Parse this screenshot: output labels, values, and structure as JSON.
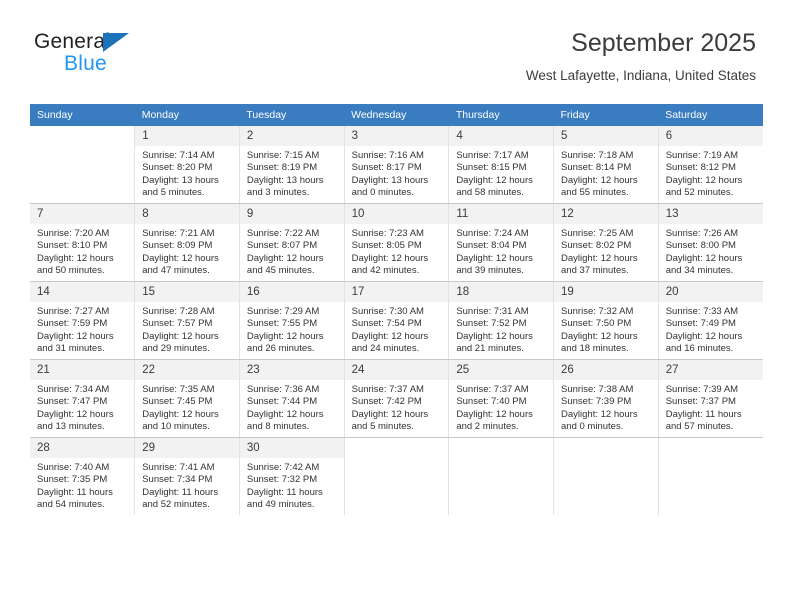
{
  "brand": {
    "name_top": "General",
    "name_bottom": "Blue",
    "triangle_color": "#1c72bb",
    "blue_color": "#2196f3"
  },
  "header": {
    "title": "September 2025",
    "subtitle": "West Lafayette, Indiana, United States"
  },
  "theme": {
    "header_row_bg": "#3a7cc0",
    "header_row_text": "#ffffff",
    "daynum_bg": "#f2f2f2",
    "cell_text": "#333333"
  },
  "weekday_headers": [
    "Sunday",
    "Monday",
    "Tuesday",
    "Wednesday",
    "Thursday",
    "Friday",
    "Saturday"
  ],
  "weeks": [
    [
      {
        "day": "",
        "sunrise": "",
        "sunset": "",
        "daylight_line1": "",
        "daylight_line2": "",
        "blank": true
      },
      {
        "day": "1",
        "sunrise": "Sunrise: 7:14 AM",
        "sunset": "Sunset: 8:20 PM",
        "daylight_line1": "Daylight: 13 hours",
        "daylight_line2": "and 5 minutes."
      },
      {
        "day": "2",
        "sunrise": "Sunrise: 7:15 AM",
        "sunset": "Sunset: 8:19 PM",
        "daylight_line1": "Daylight: 13 hours",
        "daylight_line2": "and 3 minutes."
      },
      {
        "day": "3",
        "sunrise": "Sunrise: 7:16 AM",
        "sunset": "Sunset: 8:17 PM",
        "daylight_line1": "Daylight: 13 hours",
        "daylight_line2": "and 0 minutes."
      },
      {
        "day": "4",
        "sunrise": "Sunrise: 7:17 AM",
        "sunset": "Sunset: 8:15 PM",
        "daylight_line1": "Daylight: 12 hours",
        "daylight_line2": "and 58 minutes."
      },
      {
        "day": "5",
        "sunrise": "Sunrise: 7:18 AM",
        "sunset": "Sunset: 8:14 PM",
        "daylight_line1": "Daylight: 12 hours",
        "daylight_line2": "and 55 minutes."
      },
      {
        "day": "6",
        "sunrise": "Sunrise: 7:19 AM",
        "sunset": "Sunset: 8:12 PM",
        "daylight_line1": "Daylight: 12 hours",
        "daylight_line2": "and 52 minutes."
      }
    ],
    [
      {
        "day": "7",
        "sunrise": "Sunrise: 7:20 AM",
        "sunset": "Sunset: 8:10 PM",
        "daylight_line1": "Daylight: 12 hours",
        "daylight_line2": "and 50 minutes."
      },
      {
        "day": "8",
        "sunrise": "Sunrise: 7:21 AM",
        "sunset": "Sunset: 8:09 PM",
        "daylight_line1": "Daylight: 12 hours",
        "daylight_line2": "and 47 minutes."
      },
      {
        "day": "9",
        "sunrise": "Sunrise: 7:22 AM",
        "sunset": "Sunset: 8:07 PM",
        "daylight_line1": "Daylight: 12 hours",
        "daylight_line2": "and 45 minutes."
      },
      {
        "day": "10",
        "sunrise": "Sunrise: 7:23 AM",
        "sunset": "Sunset: 8:05 PM",
        "daylight_line1": "Daylight: 12 hours",
        "daylight_line2": "and 42 minutes."
      },
      {
        "day": "11",
        "sunrise": "Sunrise: 7:24 AM",
        "sunset": "Sunset: 8:04 PM",
        "daylight_line1": "Daylight: 12 hours",
        "daylight_line2": "and 39 minutes."
      },
      {
        "day": "12",
        "sunrise": "Sunrise: 7:25 AM",
        "sunset": "Sunset: 8:02 PM",
        "daylight_line1": "Daylight: 12 hours",
        "daylight_line2": "and 37 minutes."
      },
      {
        "day": "13",
        "sunrise": "Sunrise: 7:26 AM",
        "sunset": "Sunset: 8:00 PM",
        "daylight_line1": "Daylight: 12 hours",
        "daylight_line2": "and 34 minutes."
      }
    ],
    [
      {
        "day": "14",
        "sunrise": "Sunrise: 7:27 AM",
        "sunset": "Sunset: 7:59 PM",
        "daylight_line1": "Daylight: 12 hours",
        "daylight_line2": "and 31 minutes."
      },
      {
        "day": "15",
        "sunrise": "Sunrise: 7:28 AM",
        "sunset": "Sunset: 7:57 PM",
        "daylight_line1": "Daylight: 12 hours",
        "daylight_line2": "and 29 minutes."
      },
      {
        "day": "16",
        "sunrise": "Sunrise: 7:29 AM",
        "sunset": "Sunset: 7:55 PM",
        "daylight_line1": "Daylight: 12 hours",
        "daylight_line2": "and 26 minutes."
      },
      {
        "day": "17",
        "sunrise": "Sunrise: 7:30 AM",
        "sunset": "Sunset: 7:54 PM",
        "daylight_line1": "Daylight: 12 hours",
        "daylight_line2": "and 24 minutes."
      },
      {
        "day": "18",
        "sunrise": "Sunrise: 7:31 AM",
        "sunset": "Sunset: 7:52 PM",
        "daylight_line1": "Daylight: 12 hours",
        "daylight_line2": "and 21 minutes."
      },
      {
        "day": "19",
        "sunrise": "Sunrise: 7:32 AM",
        "sunset": "Sunset: 7:50 PM",
        "daylight_line1": "Daylight: 12 hours",
        "daylight_line2": "and 18 minutes."
      },
      {
        "day": "20",
        "sunrise": "Sunrise: 7:33 AM",
        "sunset": "Sunset: 7:49 PM",
        "daylight_line1": "Daylight: 12 hours",
        "daylight_line2": "and 16 minutes."
      }
    ],
    [
      {
        "day": "21",
        "sunrise": "Sunrise: 7:34 AM",
        "sunset": "Sunset: 7:47 PM",
        "daylight_line1": "Daylight: 12 hours",
        "daylight_line2": "and 13 minutes."
      },
      {
        "day": "22",
        "sunrise": "Sunrise: 7:35 AM",
        "sunset": "Sunset: 7:45 PM",
        "daylight_line1": "Daylight: 12 hours",
        "daylight_line2": "and 10 minutes."
      },
      {
        "day": "23",
        "sunrise": "Sunrise: 7:36 AM",
        "sunset": "Sunset: 7:44 PM",
        "daylight_line1": "Daylight: 12 hours",
        "daylight_line2": "and 8 minutes."
      },
      {
        "day": "24",
        "sunrise": "Sunrise: 7:37 AM",
        "sunset": "Sunset: 7:42 PM",
        "daylight_line1": "Daylight: 12 hours",
        "daylight_line2": "and 5 minutes."
      },
      {
        "day": "25",
        "sunrise": "Sunrise: 7:37 AM",
        "sunset": "Sunset: 7:40 PM",
        "daylight_line1": "Daylight: 12 hours",
        "daylight_line2": "and 2 minutes."
      },
      {
        "day": "26",
        "sunrise": "Sunrise: 7:38 AM",
        "sunset": "Sunset: 7:39 PM",
        "daylight_line1": "Daylight: 12 hours",
        "daylight_line2": "and 0 minutes."
      },
      {
        "day": "27",
        "sunrise": "Sunrise: 7:39 AM",
        "sunset": "Sunset: 7:37 PM",
        "daylight_line1": "Daylight: 11 hours",
        "daylight_line2": "and 57 minutes."
      }
    ],
    [
      {
        "day": "28",
        "sunrise": "Sunrise: 7:40 AM",
        "sunset": "Sunset: 7:35 PM",
        "daylight_line1": "Daylight: 11 hours",
        "daylight_line2": "and 54 minutes."
      },
      {
        "day": "29",
        "sunrise": "Sunrise: 7:41 AM",
        "sunset": "Sunset: 7:34 PM",
        "daylight_line1": "Daylight: 11 hours",
        "daylight_line2": "and 52 minutes."
      },
      {
        "day": "30",
        "sunrise": "Sunrise: 7:42 AM",
        "sunset": "Sunset: 7:32 PM",
        "daylight_line1": "Daylight: 11 hours",
        "daylight_line2": "and 49 minutes."
      },
      {
        "day": "",
        "sunrise": "",
        "sunset": "",
        "daylight_line1": "",
        "daylight_line2": "",
        "blank": true
      },
      {
        "day": "",
        "sunrise": "",
        "sunset": "",
        "daylight_line1": "",
        "daylight_line2": "",
        "blank": true
      },
      {
        "day": "",
        "sunrise": "",
        "sunset": "",
        "daylight_line1": "",
        "daylight_line2": "",
        "blank": true
      },
      {
        "day": "",
        "sunrise": "",
        "sunset": "",
        "daylight_line1": "",
        "daylight_line2": "",
        "blank": true
      }
    ]
  ]
}
